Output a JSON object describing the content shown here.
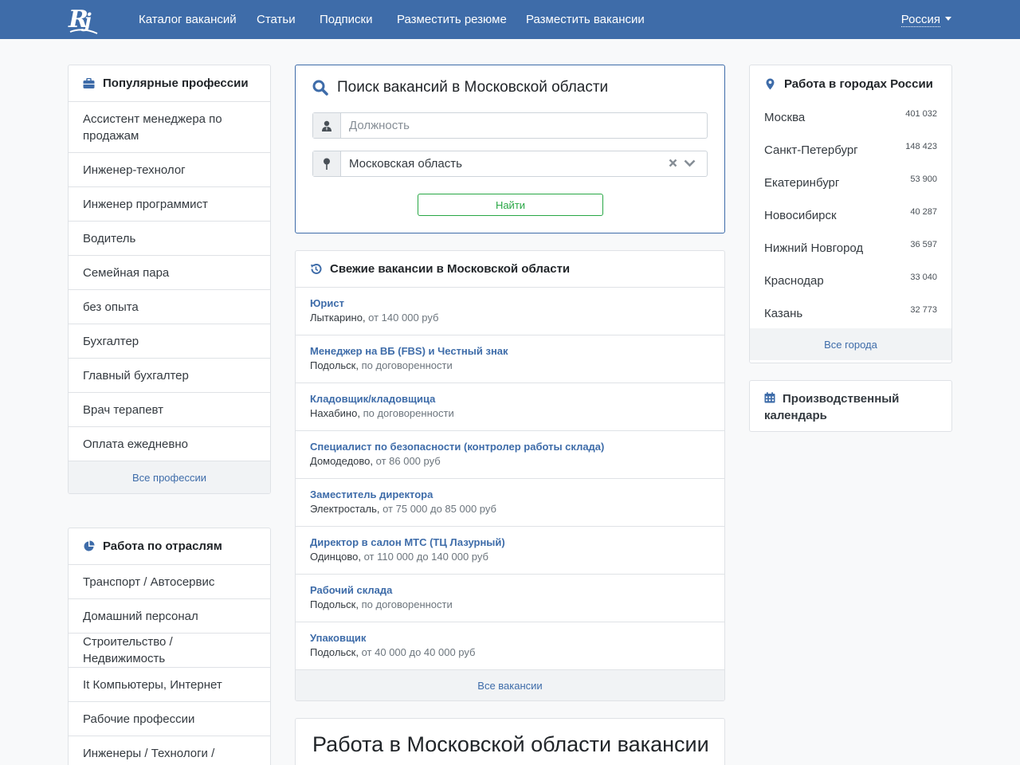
{
  "nav": {
    "links": [
      "Каталог вакансий",
      "Статьи",
      "Подписки",
      "Разместить резюме",
      "Разместить вакансии"
    ],
    "region": "Россия",
    "brand_color": "#3e6ca9"
  },
  "professions": {
    "title": "Популярные профессии",
    "icon": "briefcase-icon",
    "items": [
      "Ассистент менеджера по продажам",
      "Инженер-технолог",
      "Инженер программист",
      "Водитель",
      "Семейная пара",
      "без опыта",
      "Бухгалтер",
      "Главный бухгалтер",
      "Врач терапевт",
      "Оплата ежедневно"
    ],
    "footer": "Все профессии"
  },
  "industries": {
    "title": "Работа по отраслям",
    "icon": "pie-chart-icon",
    "items": [
      "Транспорт / Автосервис",
      "Домашний персонал",
      "Строительство / Недвижимость",
      "It Компьютеры, Интернет",
      "Рабочие профессии",
      "Инженеры / Технологи /"
    ]
  },
  "search": {
    "title": "Поиск вакансий в Московской области",
    "position_placeholder": "Должность",
    "region_value": "Московская область",
    "button": "Найти",
    "button_color": "#28a745"
  },
  "fresh": {
    "title": "Свежие вакансии в Московской области",
    "icon": "history-icon",
    "items": [
      {
        "title": "Юрист",
        "city": "Лыткарино",
        "salary": "от 140 000 руб"
      },
      {
        "title": "Менеджер на ВБ (FBS) и Честный знак",
        "city": "Подольск",
        "salary": "по договоренности"
      },
      {
        "title": "Кладовщик/кладовщица",
        "city": "Нахабино",
        "salary": "по договоренности"
      },
      {
        "title": "Специалист по безопасности (контролер работы склада)",
        "city": "Домодедово",
        "salary": "от 86 000 руб"
      },
      {
        "title": "Заместитель директора",
        "city": "Электросталь",
        "salary": "от 75 000 до 85 000 руб"
      },
      {
        "title": "Директор в салон МТС (ТЦ Лазурный)",
        "city": "Одинцово",
        "salary": "от 110 000 до 140 000 руб"
      },
      {
        "title": "Рабочий склада",
        "city": "Подольск",
        "salary": "по договоренности"
      },
      {
        "title": "Упаковщик",
        "city": "Подольск",
        "salary": "от 40 000 до 40 000 руб"
      }
    ],
    "footer": "Все вакансии"
  },
  "cities": {
    "title": "Работа в городах России",
    "icon": "map-marker-icon",
    "items": [
      {
        "name": "Москва",
        "count": "401 032"
      },
      {
        "name": "Санкт-Петербург",
        "count": "148 423"
      },
      {
        "name": "Екатеринбург",
        "count": "53 900"
      },
      {
        "name": "Новосибирск",
        "count": "40 287"
      },
      {
        "name": "Нижний Новгород",
        "count": "36 597"
      },
      {
        "name": "Краснодар",
        "count": "33 040"
      },
      {
        "name": "Казань",
        "count": "32 773"
      }
    ],
    "footer": "Все города"
  },
  "calendar": {
    "title": "Производственный календарь",
    "icon": "calendar-icon"
  },
  "bottom": {
    "title": "Работа в Московской области вакансии"
  }
}
